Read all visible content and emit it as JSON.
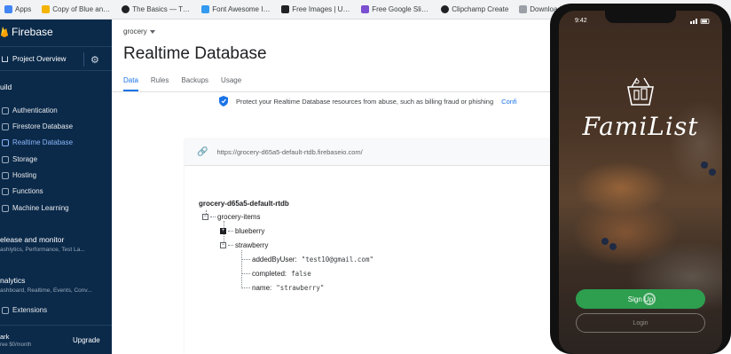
{
  "bookmarks": [
    {
      "label": "Apps",
      "color": "#4285f4"
    },
    {
      "label": "Copy of Blue and...",
      "color": "#f4b400"
    },
    {
      "label": "The Basics — The...",
      "color": "#202124"
    },
    {
      "label": "Font Awesome Ico...",
      "color": "#339af0"
    },
    {
      "label": "Free Images | Un...",
      "color": "#202124"
    },
    {
      "label": "Free Google Slide...",
      "color": "#7b4fd1"
    },
    {
      "label": "Clipchamp Create",
      "color": "#202124"
    },
    {
      "label": "Download free Bl...",
      "color": "#9aa0a6"
    }
  ],
  "sidebar": {
    "brand": "Firebase",
    "project_overview": "Project Overview",
    "build_section": "uild",
    "build_items": [
      {
        "label": "Authentication",
        "active": false
      },
      {
        "label": "Firestore Database",
        "active": false
      },
      {
        "label": "Realtime Database",
        "active": true
      },
      {
        "label": "Storage",
        "active": false
      },
      {
        "label": "Hosting",
        "active": false
      },
      {
        "label": "Functions",
        "active": false
      },
      {
        "label": "Machine Learning",
        "active": false
      }
    ],
    "release_section": "elease and monitor",
    "release_sub": "ashlytics, Performance, Test La...",
    "analytics_section": "nalytics",
    "analytics_sub": "ashboard, Realtime, Events, Conv...",
    "extensions": "Extensions",
    "plan": "ark",
    "plan_sub": "ree $0/month",
    "upgrade": "Upgrade"
  },
  "main": {
    "project": "grocery",
    "title": "Realtime Database",
    "tabs": [
      {
        "label": "Data",
        "active": true
      },
      {
        "label": "Rules",
        "active": false
      },
      {
        "label": "Backups",
        "active": false
      },
      {
        "label": "Usage",
        "active": false
      }
    ],
    "notice": "Protect your Realtime Database resources from abuse, such as billing fraud or phishing",
    "notice_link": "Confi",
    "db_url": "https://grocery-d65a5-default-rtdb.firebaseio.com/",
    "tree": {
      "root": "grocery-d65a5-default-rtdb",
      "collection": "grocery-items",
      "collapsed_child": "blueberry",
      "expanded_child": "strawberry",
      "fields": [
        {
          "key": "addedByUser:",
          "value": "\"test10@gmail.com\""
        },
        {
          "key": "completed:",
          "value": "false"
        },
        {
          "key": "name:",
          "value": "\"strawberry\""
        }
      ]
    }
  },
  "phone": {
    "time": "9:42",
    "app_title": "FamiList",
    "primary_button": "Sign Up",
    "secondary_button": "Login",
    "brand_green": "#2e9e4f"
  }
}
